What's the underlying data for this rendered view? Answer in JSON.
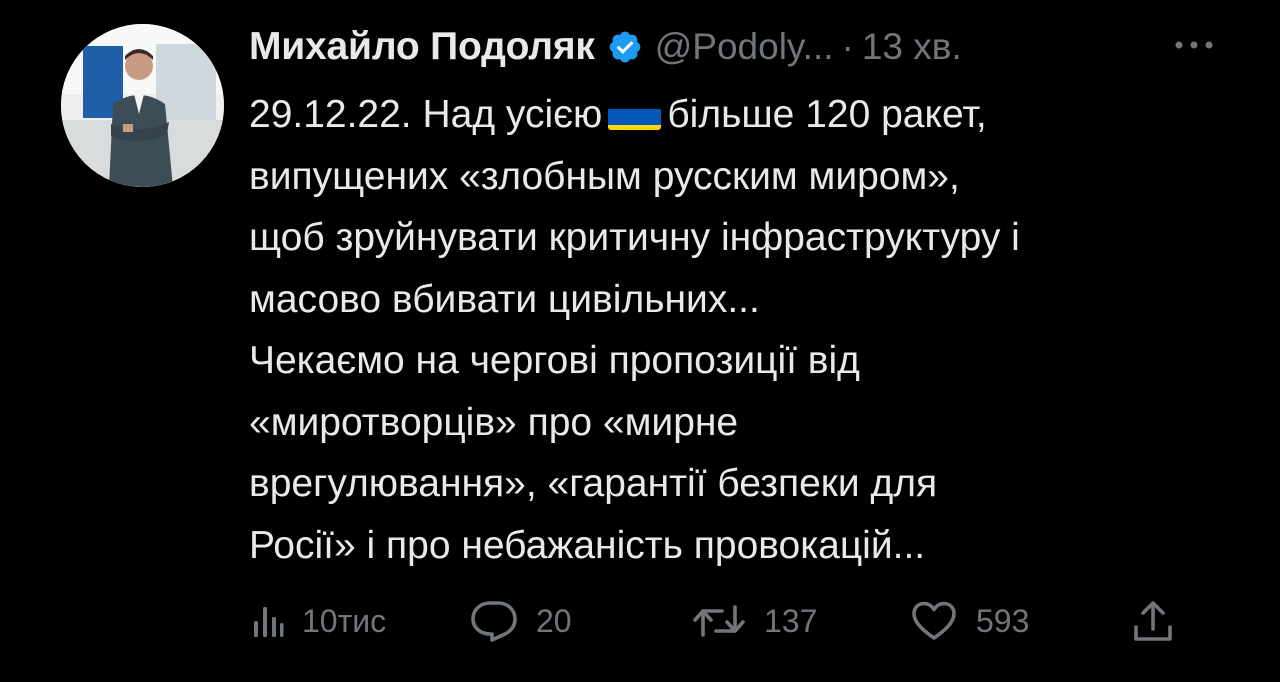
{
  "tweet": {
    "author": {
      "display_name": "Михайло Подоляк",
      "handle": "@Podoly...",
      "verified": true
    },
    "separator": "·",
    "time": "13 хв.",
    "text_lines": [
      {
        "before_flag": "29.12.22. Над усією",
        "after_flag": "більше 120 ракет,"
      },
      "випущених «злобным русским миром»,",
      "щоб зруйнувати критичну інфраструктуру і",
      "масово вбивати цивільних...",
      "Чекаємо на чергові пропозиції від",
      "«миротворців» про «мирне",
      "врегулювання», «гарантії безпеки для",
      "Росії» і про небажаність провокацій..."
    ],
    "flag_icon": "ukraine-flag-emoji",
    "stats": {
      "views": "10тис",
      "replies": "20",
      "retweets": "137",
      "likes": "593"
    }
  },
  "icons": {
    "verified": "verified-badge-icon",
    "more": "more-dots-icon",
    "views": "analytics-bars-icon",
    "reply": "reply-bubble-icon",
    "retweet": "retweet-arrows-icon",
    "like": "heart-icon",
    "share": "share-upload-icon"
  },
  "colors": {
    "background": "#000000",
    "text_primary": "#e7e9ea",
    "text_secondary": "#71767b",
    "verified_blue": "#1d9bf0",
    "flag_blue": "#0057b7",
    "flag_yellow": "#ffd700"
  }
}
